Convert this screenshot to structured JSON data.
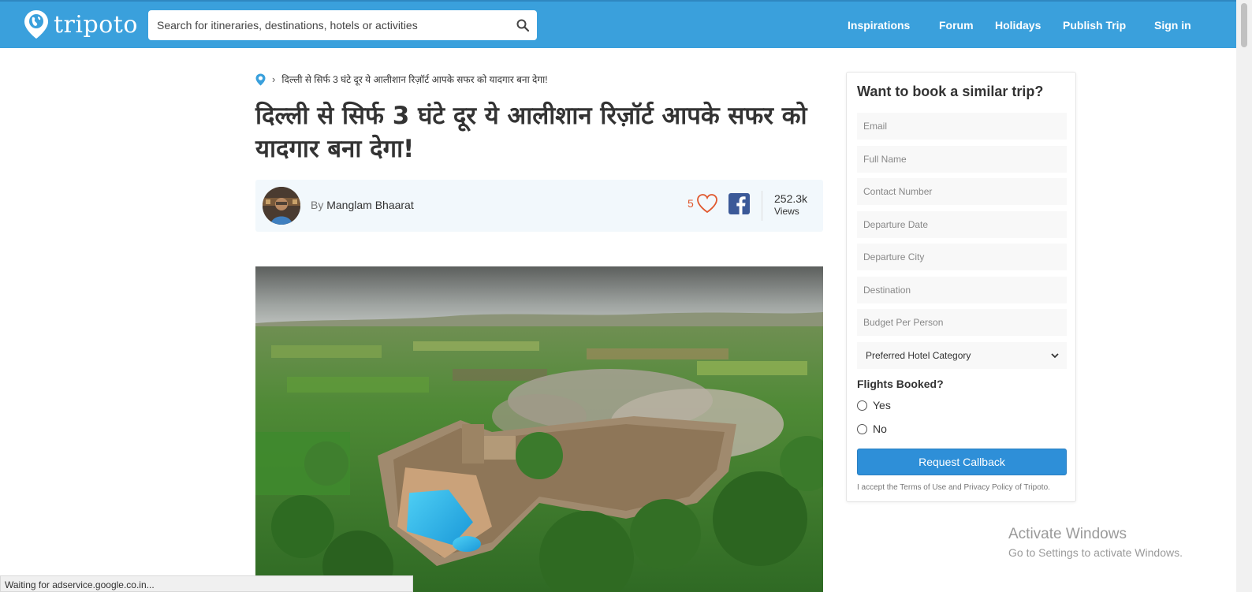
{
  "header": {
    "logo_text": "tripoto",
    "search_placeholder": "Search for itineraries, destinations, hotels or activities",
    "nav": [
      "Inspirations",
      "Forum",
      "Holidays",
      "Publish Trip",
      "Sign in"
    ]
  },
  "breadcrumb": {
    "current": "दिल्ली से सिर्फ 3 घंटे दूर ये आलीशान रिज़ॉर्ट आपके सफर को यादगार बना देगा!"
  },
  "article": {
    "title": "दिल्ली से सिर्फ 3 घंटे दूर ये आलीशान रिज़ॉर्ट आपके सफर को यादगार बना देगा!",
    "by_label": "By",
    "author": "Manglam Bhaarat",
    "likes": "5",
    "views_count": "252.3k",
    "views_label": "Views"
  },
  "booking_form": {
    "heading": "Want to book a similar trip?",
    "fields": {
      "email": "Email",
      "full_name": "Full Name",
      "contact": "Contact Number",
      "departure_date": "Departure Date",
      "departure_city": "Departure City",
      "destination": "Destination",
      "budget": "Budget Per Person"
    },
    "hotel_select": "Preferred Hotel Category",
    "flights_label": "Flights Booked?",
    "options": [
      "Yes",
      "No"
    ],
    "submit": "Request Callback",
    "terms": "I accept the Terms of Use and Privacy Policy of Tripoto."
  },
  "status_text": "Waiting for adservice.google.co.in...",
  "watermark": {
    "line1": "Activate Windows",
    "line2": "Go to Settings to activate Windows."
  },
  "colors": {
    "header_bg": "#3aa0dc",
    "button_bg": "#2e8fd8",
    "like_color": "#e0582e",
    "facebook": "#3b5998"
  }
}
